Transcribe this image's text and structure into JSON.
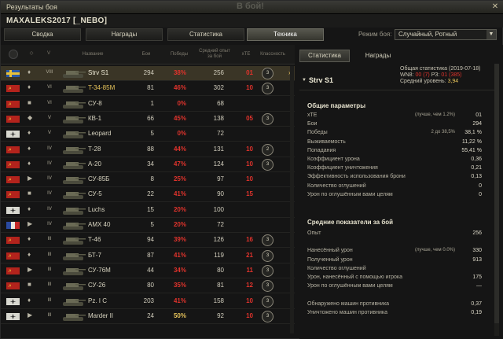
{
  "window": {
    "title": "Результаты боя",
    "ghost_text": "В бой!",
    "close_icon": "close-icon"
  },
  "player": {
    "name": "MAXALEKS2017 [_NEBO]"
  },
  "tabs": [
    {
      "label": "Сводка",
      "active": false
    },
    {
      "label": "Награды",
      "active": false
    },
    {
      "label": "Статистика",
      "active": false
    },
    {
      "label": "Техника",
      "active": true
    }
  ],
  "mode": {
    "label": "Режим боя:",
    "value": "Случайный, Ротный"
  },
  "table": {
    "headers": {
      "name": "Название",
      "battles": "Бои",
      "wins": "Победы",
      "exp": "Средний опыт за бой",
      "xte": "xTE",
      "mark": "Классность"
    },
    "rows": [
      {
        "nation": "sweden",
        "cls": "♦",
        "tier": "VIII",
        "name": "Strv S1",
        "battles": "294",
        "wr": "38%",
        "exp": "256",
        "xte": "01",
        "mark": "3",
        "wr_color": "#e0332c",
        "xte_color": "#e0332c",
        "name_color": "#f0ecd8",
        "selected": true
      },
      {
        "nation": "ussr",
        "cls": "♦",
        "tier": "VI",
        "name": "T-34-85M",
        "battles": "81",
        "wr": "46%",
        "exp": "302",
        "xte": "10",
        "mark": "3",
        "wr_color": "#e0332c",
        "xte_color": "#e0332c",
        "name_color": "#e6c35a",
        "selected": false
      },
      {
        "nation": "ussr",
        "cls": "■",
        "tier": "VI",
        "name": "СУ-8",
        "battles": "1",
        "wr": "0%",
        "exp": "68",
        "xte": "",
        "mark": "",
        "wr_color": "#e0332c",
        "xte_color": "#e0332c",
        "name_color": "#d8d4c0",
        "selected": false
      },
      {
        "nation": "ussr",
        "cls": "◆",
        "tier": "V",
        "name": "КВ-1",
        "battles": "66",
        "wr": "45%",
        "exp": "138",
        "xte": "05",
        "mark": "3",
        "wr_color": "#e0332c",
        "xte_color": "#e0332c",
        "name_color": "#d8d4c0",
        "selected": false
      },
      {
        "nation": "germany",
        "cls": "♦",
        "tier": "V",
        "name": "Leopard",
        "battles": "5",
        "wr": "0%",
        "exp": "72",
        "xte": "",
        "mark": "",
        "wr_color": "#e0332c",
        "xte_color": "#e0332c",
        "name_color": "#d8d4c0",
        "selected": false
      },
      {
        "nation": "ussr",
        "cls": "♦",
        "tier": "IV",
        "name": "Т-28",
        "battles": "88",
        "wr": "44%",
        "exp": "131",
        "xte": "10",
        "mark": "2",
        "wr_color": "#e0332c",
        "xte_color": "#e0332c",
        "name_color": "#d8d4c0",
        "selected": false
      },
      {
        "nation": "ussr",
        "cls": "♦",
        "tier": "IV",
        "name": "А-20",
        "battles": "34",
        "wr": "47%",
        "exp": "124",
        "xte": "10",
        "mark": "3",
        "wr_color": "#e0332c",
        "xte_color": "#e0332c",
        "name_color": "#d8d4c0",
        "selected": false
      },
      {
        "nation": "ussr",
        "cls": "▶",
        "tier": "IV",
        "name": "СУ-85Б",
        "battles": "8",
        "wr": "25%",
        "exp": "97",
        "xte": "10",
        "mark": "",
        "wr_color": "#e0332c",
        "xte_color": "#e0332c",
        "name_color": "#d8d4c0",
        "selected": false
      },
      {
        "nation": "ussr",
        "cls": "■",
        "tier": "IV",
        "name": "СУ-5",
        "battles": "22",
        "wr": "41%",
        "exp": "90",
        "xte": "15",
        "mark": "",
        "wr_color": "#e0332c",
        "xte_color": "#e0332c",
        "name_color": "#d8d4c0",
        "selected": false
      },
      {
        "nation": "germany",
        "cls": "♦",
        "tier": "IV",
        "name": "Luchs",
        "battles": "15",
        "wr": "20%",
        "exp": "100",
        "xte": "",
        "mark": "",
        "wr_color": "#e0332c",
        "xte_color": "#e0332c",
        "name_color": "#d8d4c0",
        "selected": false
      },
      {
        "nation": "france",
        "cls": "▶",
        "tier": "IV",
        "name": "AMX 40",
        "battles": "5",
        "wr": "20%",
        "exp": "72",
        "xte": "",
        "mark": "",
        "wr_color": "#e0332c",
        "xte_color": "#e0332c",
        "name_color": "#d8d4c0",
        "selected": false
      },
      {
        "nation": "ussr",
        "cls": "♦",
        "tier": "III",
        "name": "Т-46",
        "battles": "94",
        "wr": "39%",
        "exp": "126",
        "xte": "16",
        "mark": "3",
        "wr_color": "#e0332c",
        "xte_color": "#e0332c",
        "name_color": "#d8d4c0",
        "selected": false
      },
      {
        "nation": "ussr",
        "cls": "♦",
        "tier": "III",
        "name": "БТ-7",
        "battles": "87",
        "wr": "41%",
        "exp": "119",
        "xte": "21",
        "mark": "3",
        "wr_color": "#e0332c",
        "xte_color": "#e0332c",
        "name_color": "#d8d4c0",
        "selected": false
      },
      {
        "nation": "ussr",
        "cls": "▶",
        "tier": "III",
        "name": "СУ-76М",
        "battles": "44",
        "wr": "34%",
        "exp": "80",
        "xte": "11",
        "mark": "3",
        "wr_color": "#e0332c",
        "xte_color": "#e0332c",
        "name_color": "#d8d4c0",
        "selected": false
      },
      {
        "nation": "ussr",
        "cls": "■",
        "tier": "III",
        "name": "СУ-26",
        "battles": "80",
        "wr": "35%",
        "exp": "81",
        "xte": "12",
        "mark": "3",
        "wr_color": "#e0332c",
        "xte_color": "#e0332c",
        "name_color": "#d8d4c0",
        "selected": false
      },
      {
        "nation": "germany",
        "cls": "♦",
        "tier": "III",
        "name": "Pz. I C",
        "battles": "203",
        "wr": "41%",
        "exp": "158",
        "xte": "10",
        "mark": "3",
        "wr_color": "#e0332c",
        "xte_color": "#e0332c",
        "name_color": "#d8d4c0",
        "selected": false
      },
      {
        "nation": "germany",
        "cls": "▶",
        "tier": "III",
        "name": "Marder II",
        "battles": "24",
        "wr": "50%",
        "exp": "92",
        "xte": "10",
        "mark": "3",
        "wr_color": "#e6c35a",
        "xte_color": "#e0332c",
        "name_color": "#d8d4c0",
        "selected": false
      }
    ]
  },
  "right": {
    "tabs": [
      {
        "label": "Статистика",
        "active": true
      },
      {
        "label": "Награды",
        "active": false
      }
    ],
    "vehicle": "Strv S1",
    "general": "Общая статистика (2019-07-18)",
    "wn8_label": "WN8:",
    "wn8_value": "00",
    "wn8_paren": "(7)",
    "rz_label": "РЗ:",
    "rz_value": "01",
    "rz_paren": "(385)",
    "level_label": "Средний уровень:",
    "level_value": "3,94",
    "section1": "Общие параметры",
    "stats1": [
      {
        "label": "xTE",
        "note": "(лучше, чем 1.2%)",
        "value": "01"
      },
      {
        "label": "Бои",
        "note": "",
        "value": "294"
      },
      {
        "label": "Победы",
        "note": "2 до 38,5%",
        "value": "38,1 %"
      },
      {
        "label": "Выживаемость",
        "note": "",
        "value": "11,22 %"
      },
      {
        "label": "Попадания",
        "note": "",
        "value": "55,41 %"
      },
      {
        "label": "Коэффициент урона",
        "note": "",
        "value": "0,36"
      },
      {
        "label": "Коэффициент уничтожения",
        "note": "",
        "value": "0,21"
      },
      {
        "label": "Эффективность использования брони",
        "note": "",
        "value": "0,13"
      },
      {
        "label": "Количество оглушений",
        "note": "",
        "value": "0"
      },
      {
        "label": "Урон по оглушённым вами целям",
        "note": "",
        "value": "0"
      }
    ],
    "section2": "Средние показатели за бой",
    "stats2": [
      {
        "label": "Опыт",
        "note": "",
        "value": "256"
      },
      {
        "label": "",
        "note": "",
        "value": ""
      },
      {
        "label": "Нанесённый урон",
        "note": "(лучше, чем 0.0%)",
        "value": "330"
      },
      {
        "label": "Полученный урон",
        "note": "",
        "value": "913"
      },
      {
        "label": "Количество оглушений",
        "note": "",
        "value": ""
      },
      {
        "label": "Урон, нанесённый с помощью игрока",
        "note": "",
        "value": "175"
      },
      {
        "label": "Урон по оглушённым вами целям",
        "note": "",
        "value": "—"
      },
      {
        "label": "",
        "note": "",
        "value": ""
      },
      {
        "label": "Обнаружено машин противника",
        "note": "",
        "value": "0,37"
      },
      {
        "label": "Уничтожено машин противника",
        "note": "",
        "value": "0,19"
      }
    ]
  },
  "colors": {
    "red": "#e0332c",
    "yellow": "#e6c35a",
    "highlight": "#3a3526"
  }
}
